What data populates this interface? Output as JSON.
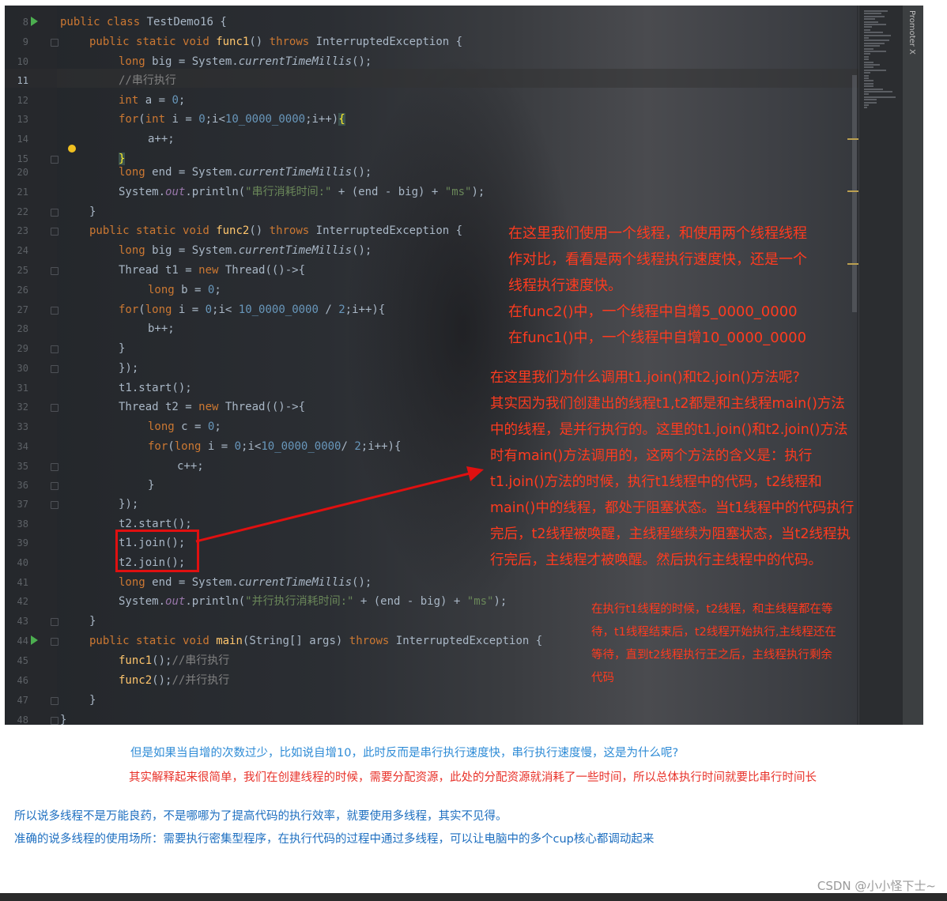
{
  "editor": {
    "panel_label": "Promoter X",
    "lines": [
      {
        "n": "8",
        "text": "public class TestDemo16 {"
      },
      {
        "n": "9",
        "text": "public static void func1() throws InterruptedException {"
      },
      {
        "n": "10",
        "text": "long big = System.currentTimeMillis();"
      },
      {
        "n": "11",
        "text": "//串行执行"
      },
      {
        "n": "12",
        "text": "int a = 0;"
      },
      {
        "n": "13",
        "text": "for(int i = 0;i<10_0000_0000;i++){"
      },
      {
        "n": "14",
        "text": "a++;"
      },
      {
        "n": "15",
        "text": "}"
      },
      {
        "n": "20",
        "text": "long end = System.currentTimeMillis();"
      },
      {
        "n": "21",
        "text": "System.out.println(\"串行消耗时间:\" + (end - big) + \"ms\");"
      },
      {
        "n": "22",
        "text": "}"
      },
      {
        "n": "23",
        "text": "public static void func2() throws InterruptedException {"
      },
      {
        "n": "24",
        "text": "long big = System.currentTimeMillis();"
      },
      {
        "n": "25",
        "text": "Thread t1 = new Thread(()->{"
      },
      {
        "n": "26",
        "text": "long b = 0;"
      },
      {
        "n": "27",
        "text": "for(long i = 0;i< 10_0000_0000 / 2;i++){"
      },
      {
        "n": "28",
        "text": "b++;"
      },
      {
        "n": "29",
        "text": "}"
      },
      {
        "n": "30",
        "text": "});"
      },
      {
        "n": "31",
        "text": "t1.start();"
      },
      {
        "n": "32",
        "text": "Thread t2 = new Thread(()->{"
      },
      {
        "n": "33",
        "text": "long c = 0;"
      },
      {
        "n": "34",
        "text": "for(long i = 0;i<10_0000_0000/ 2;i++){"
      },
      {
        "n": "35",
        "text": "c++;"
      },
      {
        "n": "36",
        "text": "}"
      },
      {
        "n": "37",
        "text": "});"
      },
      {
        "n": "38",
        "text": "t2.start();"
      },
      {
        "n": "39",
        "text": "t1.join();"
      },
      {
        "n": "40",
        "text": "t2.join();"
      },
      {
        "n": "41",
        "text": "long end = System.currentTimeMillis();"
      },
      {
        "n": "42",
        "text": "System.out.println(\"并行执行消耗时间:\" + (end - big) + \"ms\");"
      },
      {
        "n": "43",
        "text": "}"
      },
      {
        "n": "44",
        "text": "public static void main(String[] args) throws InterruptedException {"
      },
      {
        "n": "45",
        "text": "func1();//串行执行"
      },
      {
        "n": "46",
        "text": "func2();//并行执行"
      },
      {
        "n": "47",
        "text": "}"
      },
      {
        "n": "48",
        "text": "}"
      }
    ]
  },
  "annotations": {
    "box1": [
      "在这里我们使用一个线程，和使用两个线程线程",
      "作对比，看看是两个线程执行速度快，还是一个",
      "线程执行速度快。",
      "在func2()中，一个线程中自增5_0000_0000",
      "在func1()中，一个线程中自增10_0000_0000"
    ],
    "box2": [
      "在这里我们为什么调用t1.join()和t2.join()方法呢?",
      "其实因为我们创建出的线程t1,t2都是和主线程main()方法",
      "中的线程，是并行执行的。这里的t1.join()和t2.join()方法",
      "时有main()方法调用的，这两个方法的含义是：执行",
      "t1.join()方法的时候，执行t1线程中的代码，t2线程和",
      "main()中的线程，都处于阻塞状态。当t1线程中的代码执行",
      "完后，t2线程被唤醒，主线程继续为阻塞状态，当t2线程执",
      "行完后，主线程才被唤醒。然后执行主线程中的代码。"
    ],
    "box3": [
      "在执行t1线程的时候，t2线程，和主线程都在等",
      "待，t1线程结束后，t2线程开始执行,主线程还在",
      "等待，直到t2线程执行王之后，主线程执行剩余",
      "代码"
    ]
  },
  "notes": {
    "question": "但是如果当自增的次数过少，比如说自增10，此时反而是串行执行速度快，串行执行速度慢，这是为什么呢?",
    "explanation": "其实解释起来很简单，我们在创建线程的时候，需要分配资源，此处的分配资源就消耗了一些时间，所以总体执行时间就要比串行时间长",
    "conclusion1": "所以说多线程不是万能良药，不是哪哪为了提高代码的执行效率，就要使用多线程，其实不见得。",
    "conclusion2": "准确的说多线程的使用场所：需要执行密集型程序，在执行代码的过程中通过多线程，可以让电脑中的多个cup核心都调动起来"
  },
  "watermark": "CSDN @小小怪下士~",
  "colors": {
    "keyword": "#cc7832",
    "method": "#ffc66d",
    "number": "#6897bb",
    "string": "#6a8759",
    "annotation": "#ff3b1f",
    "note_blue": "#2e8bd6",
    "note_red": "#e8322a"
  }
}
